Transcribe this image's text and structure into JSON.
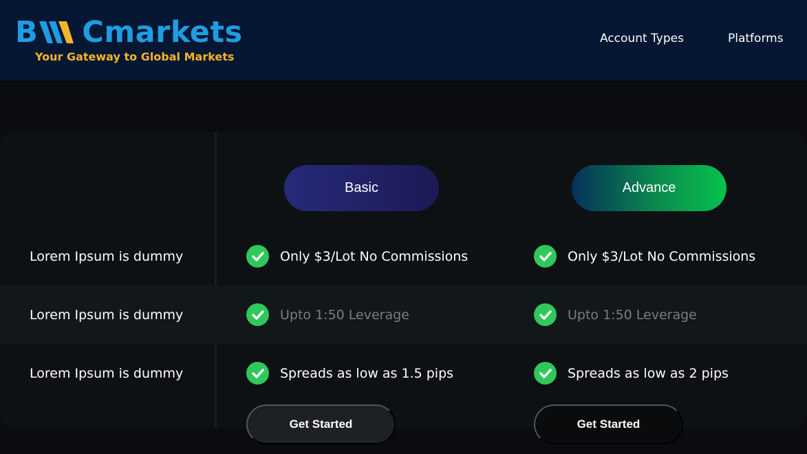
{
  "header": {
    "logo": {
      "text_left": "B",
      "text_right": "Cmarkets",
      "tagline": "Your Gateway to Global Markets"
    },
    "nav": [
      "Account Types",
      "Platforms"
    ]
  },
  "plans": [
    {
      "label": "Basic"
    },
    {
      "label": "Advance"
    }
  ],
  "rows": [
    {
      "label": "Lorem Ipsum is dummy",
      "basic": "Only $3/Lot No Commissions",
      "advance": "Only $3/Lot No Commissions"
    },
    {
      "label": "Lorem Ipsum is dummy",
      "basic": "Upto 1:50 Leverage",
      "advance": "Upto 1:50 Leverage"
    },
    {
      "label": "Lorem Ipsum is dummy",
      "basic": "Spreads as low as 1.5 pips",
      "advance": "Spreads as low as 2 pips"
    }
  ],
  "cta_label": "Get Started",
  "colors": {
    "header_bg": "#061733",
    "logo_blue": "#1e9de3",
    "logo_gold": "#f5b52a",
    "check_green": "#2fc85a"
  }
}
